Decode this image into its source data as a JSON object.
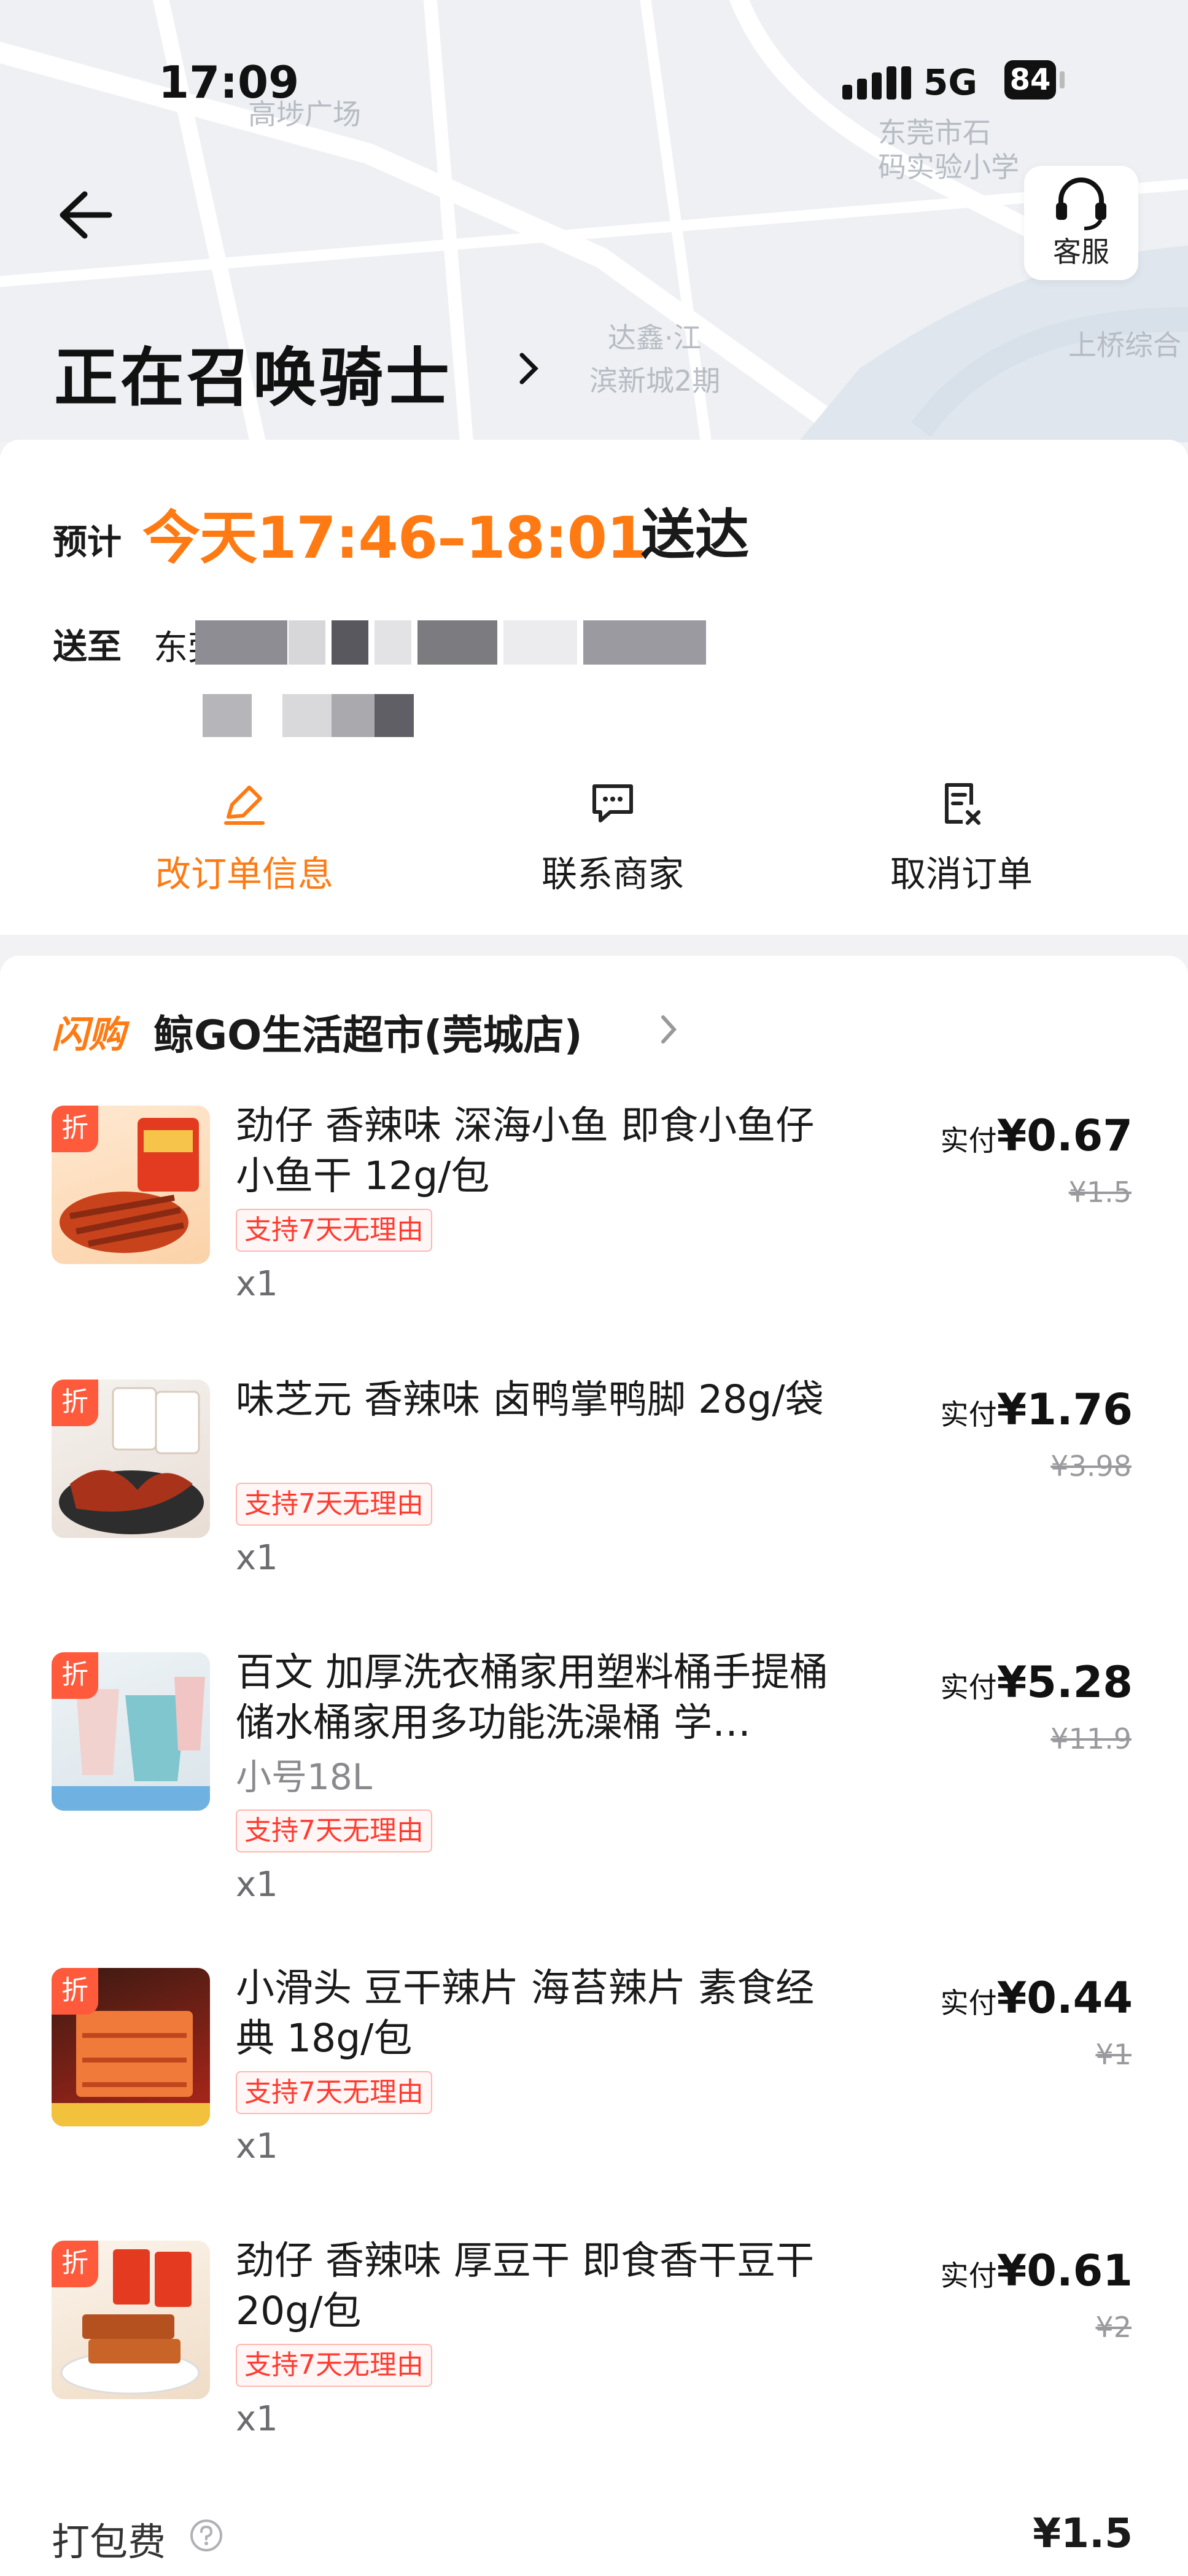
{
  "status_bar": {
    "time": "17:09",
    "network": "5G",
    "battery": "84"
  },
  "map": {
    "labels": [
      "高埗广场",
      "东莞市石",
      "码实验小学",
      "达鑫·江",
      "滨新城2期",
      "上桥综合"
    ]
  },
  "header": {
    "title": "正在召唤骑士",
    "service_label": "客服"
  },
  "eta": {
    "label": "预计",
    "time": "今天17:46–18:01",
    "suffix": "送达"
  },
  "address": {
    "label": "送至",
    "prefix": "东莞"
  },
  "actions": [
    {
      "label": "改订单信息",
      "icon": "edit-icon",
      "color": "#ff7a12"
    },
    {
      "label": "联系商家",
      "icon": "chat-icon",
      "color": "#222222"
    },
    {
      "label": "取消订单",
      "icon": "cancel-order-icon",
      "color": "#222222"
    }
  ],
  "store": {
    "channel": "闪购",
    "name": "鲸GO生活超市(莞城店)"
  },
  "items": [
    {
      "name": "劲仔 香辣味 深海小鱼 即食小鱼仔小鱼干 12g/包",
      "spec": "",
      "badge": "支持7天无理由",
      "qty": "x1",
      "pay_prefix": "实付",
      "pay": "¥0.67",
      "original": "¥1.5",
      "discount_tag": "折"
    },
    {
      "name": "味芝元 香辣味 卤鸭掌鸭脚 28g/袋",
      "spec": "",
      "badge": "支持7天无理由",
      "qty": "x1",
      "pay_prefix": "实付",
      "pay": "¥1.76",
      "original": "¥3.98",
      "discount_tag": "折"
    },
    {
      "name": "百文 加厚洗衣桶家用塑料桶手提桶 储水桶家用多功能洗澡桶 学…",
      "spec": "小号18L",
      "badge": "支持7天无理由",
      "qty": "x1",
      "pay_prefix": "实付",
      "pay": "¥5.28",
      "original": "¥11.9",
      "discount_tag": "折"
    },
    {
      "name": "小滑头 豆干辣片 海苔辣片 素食经典 18g/包",
      "spec": "",
      "badge": "支持7天无理由",
      "qty": "x1",
      "pay_prefix": "实付",
      "pay": "¥0.44",
      "original": "¥1",
      "discount_tag": "折"
    },
    {
      "name": "劲仔 香辣味 厚豆干 即食香干豆干 20g/包",
      "spec": "",
      "badge": "支持7天无理由",
      "qty": "x1",
      "pay_prefix": "实付",
      "pay": "¥0.61",
      "original": "¥2",
      "discount_tag": "折"
    }
  ],
  "packing": {
    "label": "打包费",
    "fee": "¥1.5"
  },
  "colors": {
    "accent": "#ff7a12",
    "discount_red": "#ff3b30"
  }
}
